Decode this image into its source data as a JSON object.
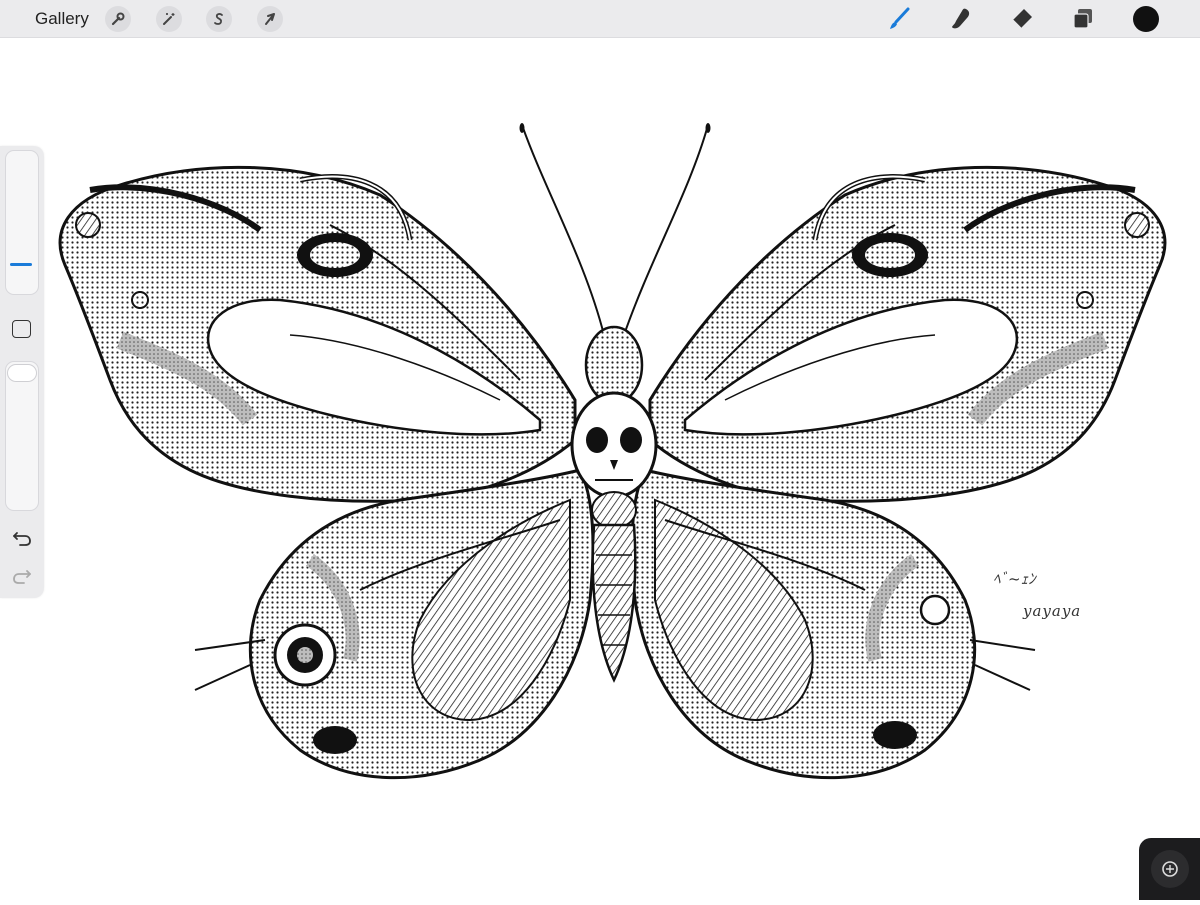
{
  "app": {
    "gallery_label": "Gallery"
  },
  "toolbar": {
    "left_tools": [
      {
        "name": "actions",
        "icon": "wrench-icon"
      },
      {
        "name": "adjustments",
        "icon": "magic-wand-icon"
      },
      {
        "name": "selection",
        "icon": "selection-s-icon"
      },
      {
        "name": "transform",
        "icon": "arrow-cursor-icon"
      }
    ],
    "right_tools": [
      {
        "name": "brush",
        "icon": "brush-icon",
        "active": true
      },
      {
        "name": "smudge",
        "icon": "smudge-icon"
      },
      {
        "name": "eraser",
        "icon": "eraser-icon"
      },
      {
        "name": "layers",
        "icon": "layers-icon"
      }
    ],
    "current_color": "#111111",
    "accent": "#1a7bd9"
  },
  "sidebar": {
    "brush_size_level": 0.15,
    "brush_opacity_level": 1.0,
    "undo_icon": "undo-arrow-icon",
    "redo_icon": "redo-arrow-icon",
    "modify_icon": "square-modify-icon"
  },
  "canvas": {
    "artwork": "butterfly ink illustration",
    "signature_line1": "ﾍﾞ~ｪﾝ",
    "signature_line2": "yayaya"
  },
  "quickmenu": {
    "icon": "quickshape-icon"
  }
}
